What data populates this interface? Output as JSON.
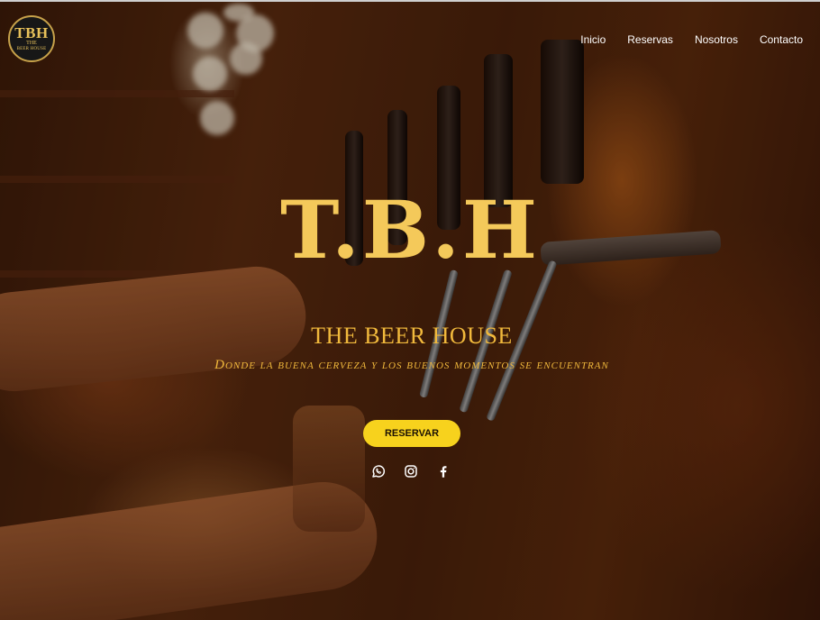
{
  "logo": {
    "line1": "TBH",
    "line2": "THE",
    "line3": "BEER HOUSE"
  },
  "nav": {
    "items": [
      "Inicio",
      "Reservas",
      "Nosotros",
      "Contacto"
    ]
  },
  "hero": {
    "title": "T.B.H",
    "subtitle": "THE BEER HOUSE",
    "tagline": "Donde la buena cerveza y los buenos momentos se encuentran",
    "cta_label": "RESERVAR"
  },
  "social": {
    "icons": [
      "whatsapp-icon",
      "instagram-icon",
      "facebook-icon"
    ]
  },
  "colors": {
    "accent": "#f4c95a",
    "button": "#f7d21d",
    "nav_text": "#ffffff"
  }
}
